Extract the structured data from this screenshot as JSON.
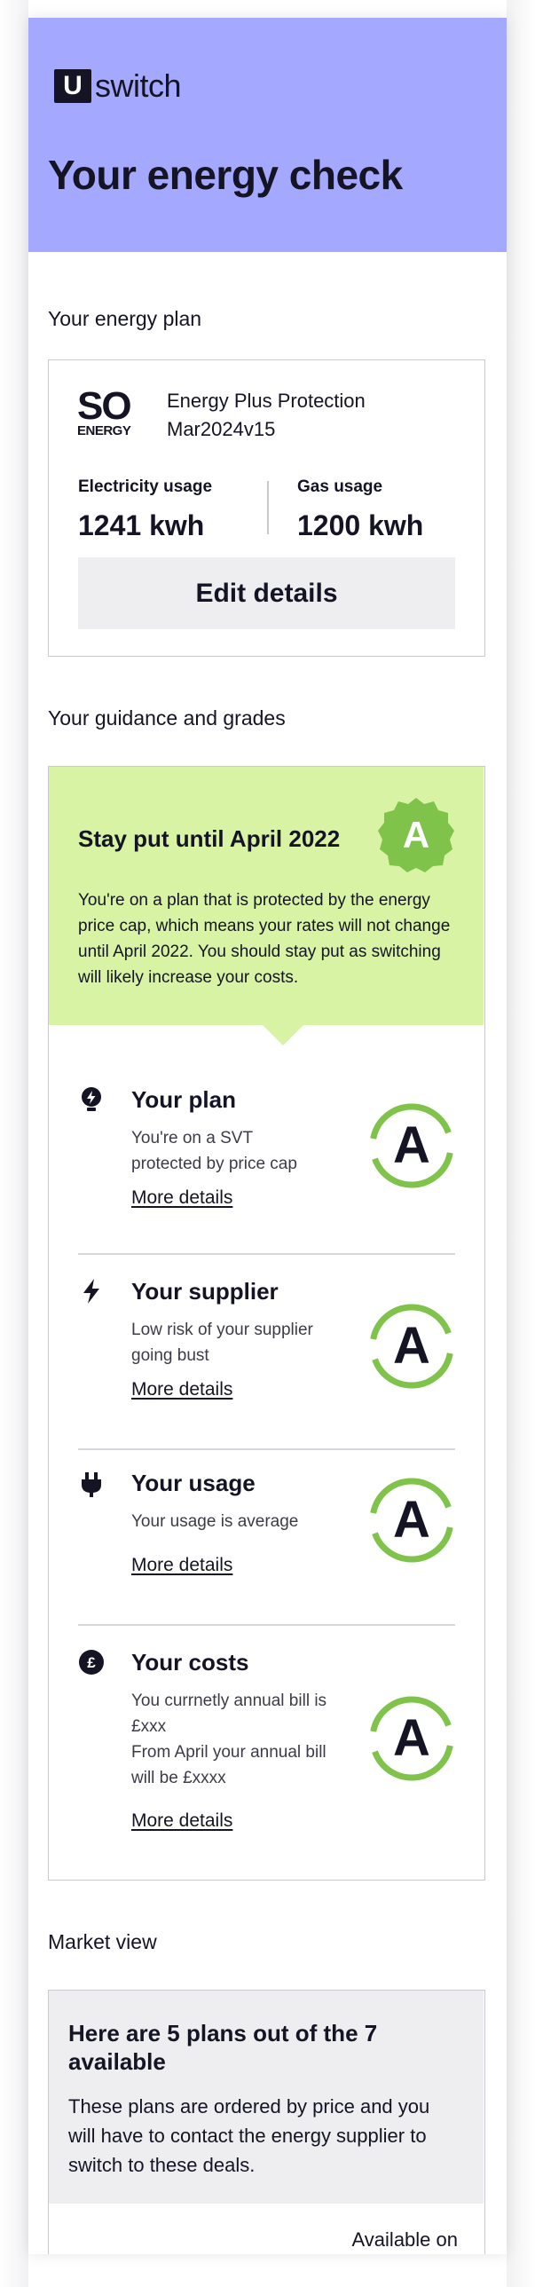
{
  "brand": {
    "logo_letter": "U",
    "logo_word": "switch"
  },
  "header": {
    "title": "Your energy check"
  },
  "energy_plan": {
    "section_title": "Your energy plan",
    "supplier_logo": {
      "line1": "SO",
      "line2": "ENERGY"
    },
    "plan_name_line1": "Energy Plus Protection",
    "plan_name_line2": "Mar2024v15",
    "electricity": {
      "label": "Electricity usage",
      "value": "1241 kwh"
    },
    "gas": {
      "label": "Gas usage",
      "value": "1200 kwh"
    },
    "edit_button": "Edit details"
  },
  "guidance": {
    "section_title": "Your guidance and grades",
    "headline": "Stay put until April 2022",
    "overall_grade": "A",
    "text": "You're on a plan that is protected by the energy price cap, which means your rates will not change until April 2022. You should stay put as switching will likely increase your costs.",
    "rows": [
      {
        "icon": "lightbulb-icon",
        "title": "Your plan",
        "desc_lines": [
          "You're on a SVT",
          "protected by price cap"
        ],
        "link": "More details",
        "grade": "A"
      },
      {
        "icon": "lightning-icon",
        "title": "Your supplier",
        "desc_lines": [
          "Low risk of your supplier",
          "going bust"
        ],
        "link": "More details",
        "grade": "A"
      },
      {
        "icon": "plug-icon",
        "title": "Your usage",
        "desc_lines": [
          "Your usage is average"
        ],
        "link": "More details",
        "grade": "A"
      },
      {
        "icon": "pound-icon",
        "title": "Your costs",
        "desc_lines": [
          "You currnetly annual bill is",
          "£xxx",
          "From April your annual bill",
          "will be £xxxx"
        ],
        "link": "More details",
        "grade": "A"
      }
    ],
    "colors": {
      "guide_bg": "#d8f3a3",
      "grade_green": "#7fc34a"
    }
  },
  "market": {
    "section_title": "Market view",
    "title": "Here are 5 plans out of the 7 available",
    "description": "These plans are ordered by price and you will have to contact the energy supplier to switch to these deals.",
    "available_label": "Available on"
  },
  "colors": {
    "header_bg": "#a5a8ff",
    "text": "#141424",
    "card_border": "#c9c9cf"
  }
}
